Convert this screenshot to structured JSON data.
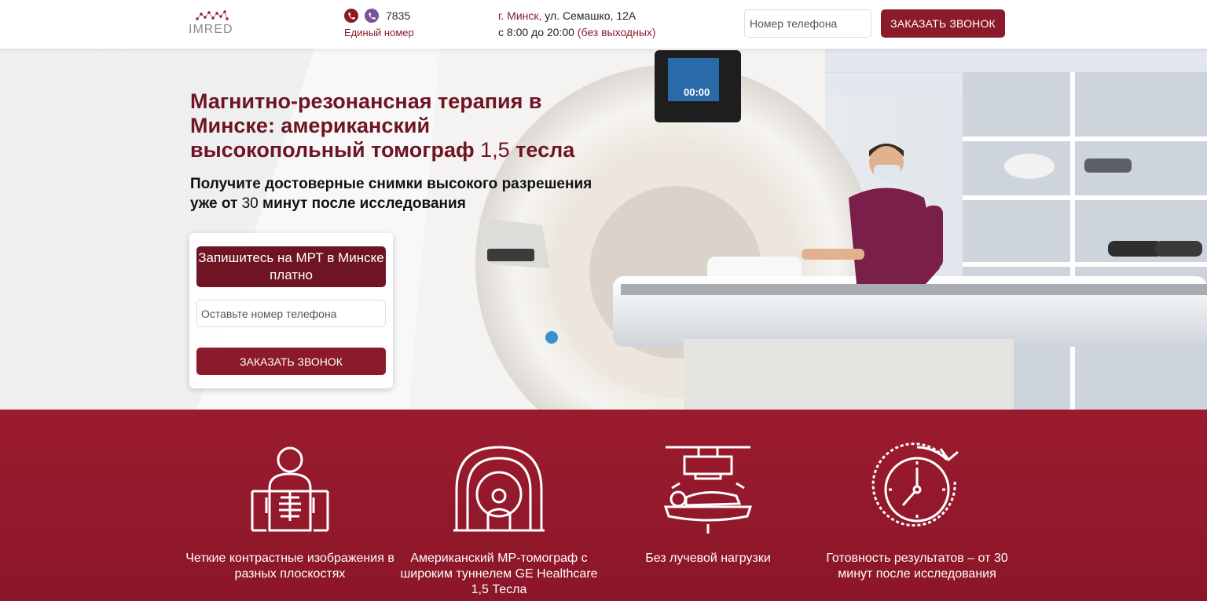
{
  "header": {
    "logo_text": "IMRED",
    "phone_number": "7835",
    "phone_caption": "Единый номер",
    "address_city": "г. Минск,",
    "address_street": "ул. Семашко, 12А",
    "hours": "с 8:00 до 20:00",
    "hours_note": "(без выходных)",
    "phone_placeholder": "Номер телефона",
    "callback_label": "ЗАКАЗАТЬ ЗВОНОК"
  },
  "hero": {
    "title_part1": "Магнитно-резонансная терапия в Минске: американский высокопольный томограф ",
    "title_number": "1,5",
    "title_part2": " тесла",
    "subtitle_part1": "Получите достоверные снимки высокого разрешения уже от ",
    "subtitle_number": "30",
    "subtitle_part2": " минут после исследования",
    "monitor_value": "00:00",
    "form": {
      "heading": "Запишитесь на МРТ в Минске платно",
      "phone_placeholder": "Оставьте номер телефона",
      "submit_label": "ЗАКАЗАТЬ ЗВОНОК"
    }
  },
  "features": [
    {
      "icon": "body-scan-icon",
      "label": "Четкие контрастные изображения в разных плоскостях"
    },
    {
      "icon": "mri-tunnel-icon",
      "label": "Американский МР-томограф с широким туннелем GE Healthcare 1,5 Тесла"
    },
    {
      "icon": "patient-table-icon",
      "label": "Без лучевой нагрузки"
    },
    {
      "icon": "clock-icon",
      "label": "Готовность результатов – от 30 минут после исследования"
    }
  ],
  "colors": {
    "brand": "#8b1a2b",
    "brand_dark": "#6e1422",
    "viber": "#7b519d"
  }
}
